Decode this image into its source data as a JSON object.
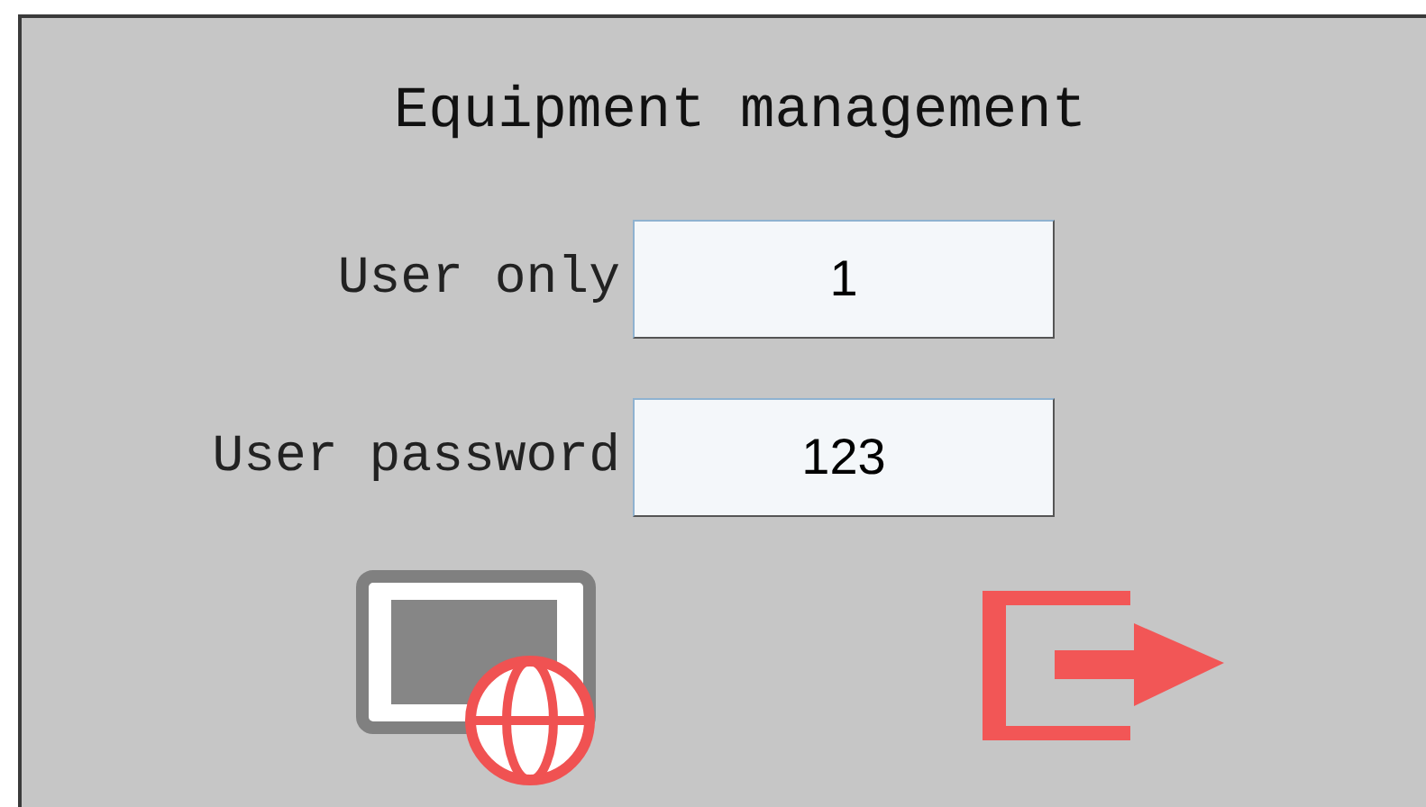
{
  "title": "Equipment management",
  "fields": [
    {
      "label": "User only",
      "value": "1"
    },
    {
      "label": "User password",
      "value": "123"
    }
  ]
}
